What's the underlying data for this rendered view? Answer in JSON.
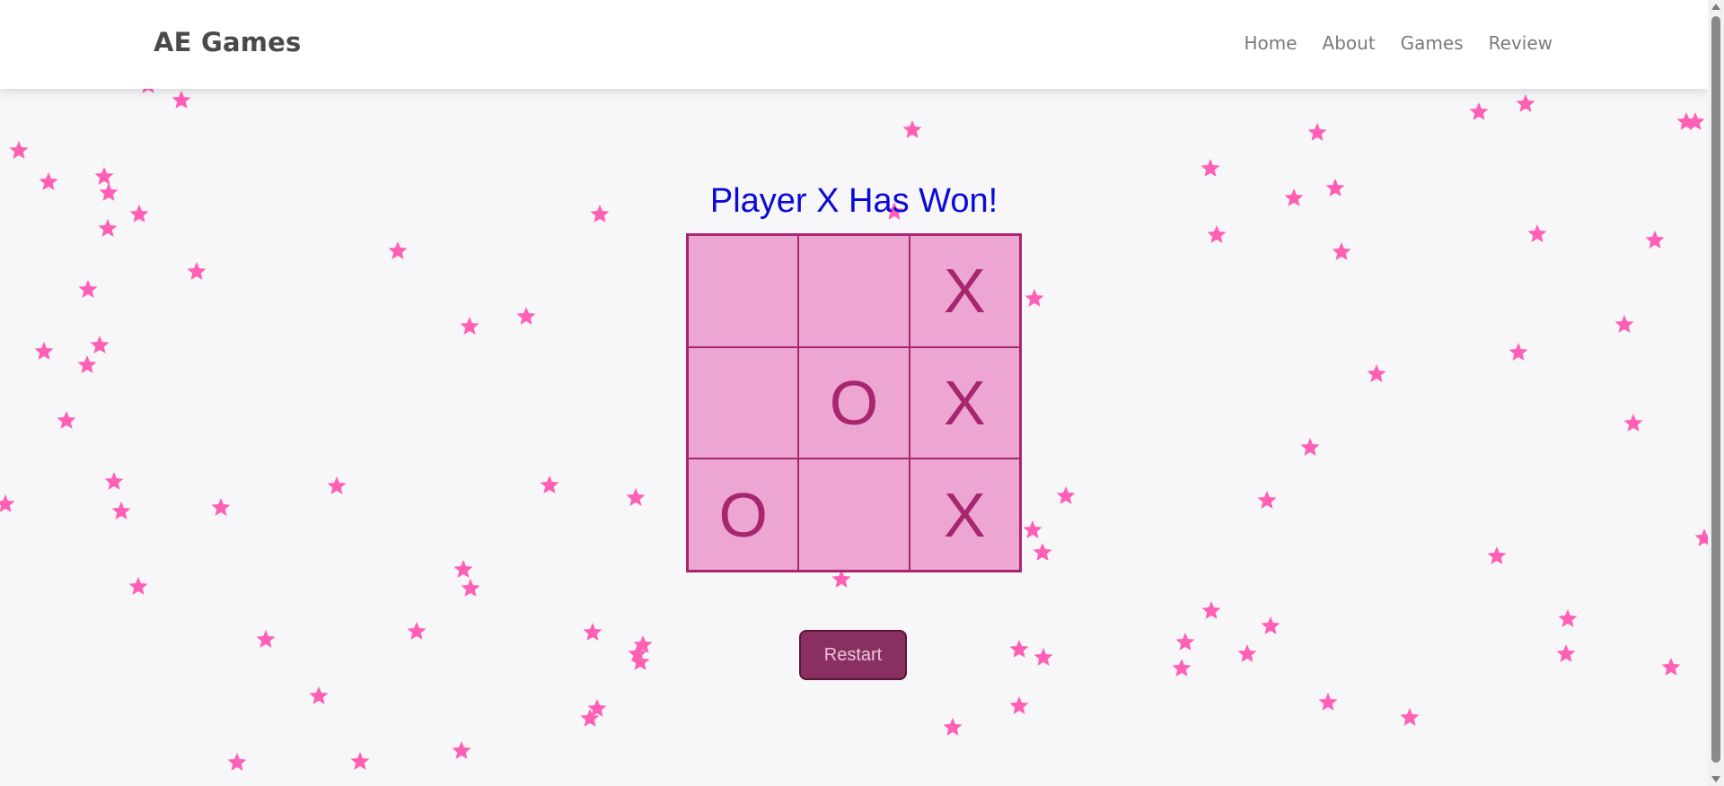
{
  "header": {
    "brand": "AE Games",
    "nav": [
      "Home",
      "About",
      "Games",
      "Review"
    ]
  },
  "game": {
    "status": "Player X Has Won!",
    "board": [
      "",
      "",
      "X",
      "",
      "O",
      "X",
      "O",
      "",
      "X"
    ],
    "restart_label": "Restart"
  },
  "colors": {
    "star": "#ff5fb4",
    "cell": "#eda6d1",
    "mark": "#a8266f",
    "status_text": "#0a0ad8",
    "restart_button": "#8a2f62"
  }
}
